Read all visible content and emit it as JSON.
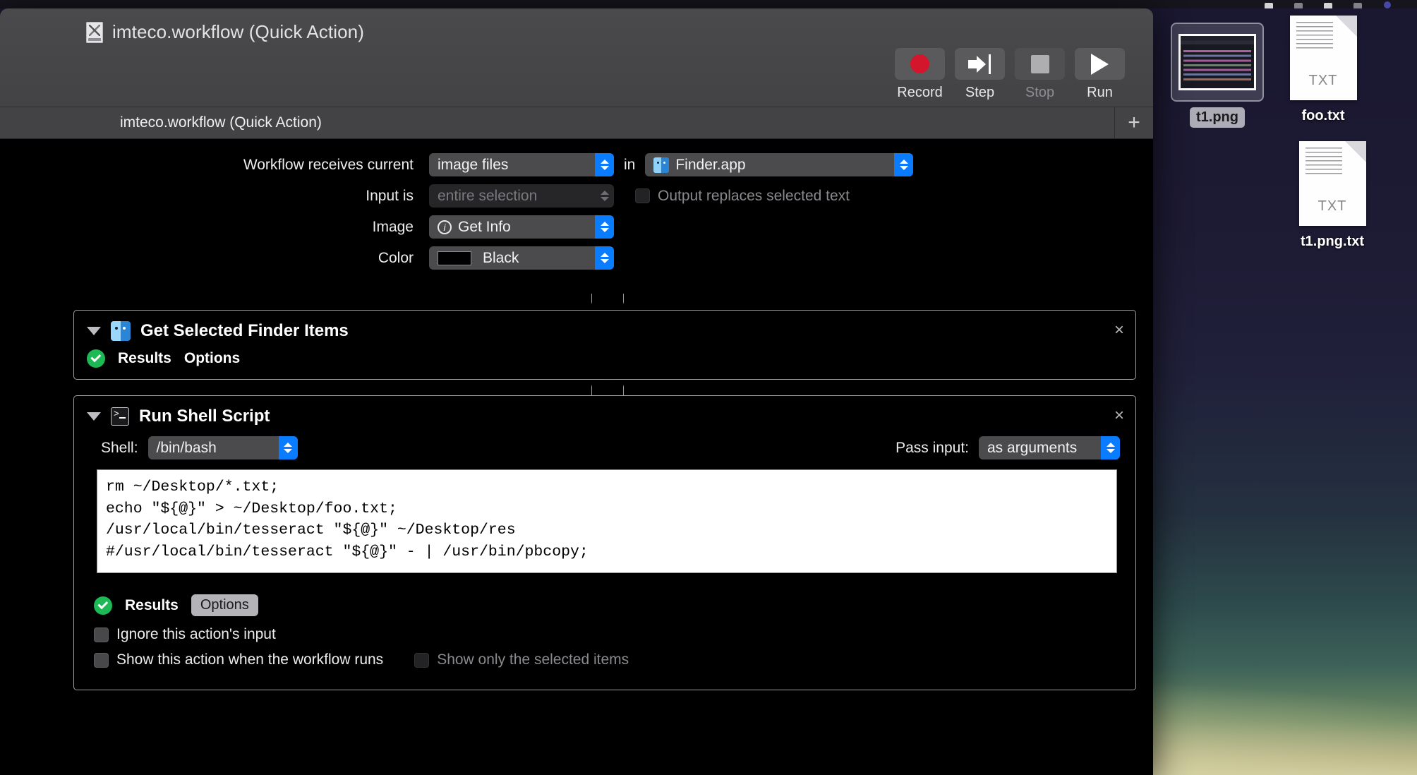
{
  "window": {
    "title": "imteco.workflow (Quick Action)",
    "doc_icon": "workflow-document-icon"
  },
  "toolbar": {
    "buttons": [
      {
        "label": "Record",
        "icon": "record-circle-icon",
        "enabled": true
      },
      {
        "label": "Step",
        "icon": "step-arrow-icon",
        "enabled": true
      },
      {
        "label": "Stop",
        "icon": "stop-square-icon",
        "enabled": false
      },
      {
        "label": "Run",
        "icon": "play-triangle-icon",
        "enabled": true
      }
    ]
  },
  "tabs": {
    "active_label": "imteco.workflow (Quick Action)",
    "add_label": "+"
  },
  "settings": {
    "receives_label": "Workflow receives current",
    "receives_value": "image files",
    "in_label": "in",
    "app_value": "Finder.app",
    "input_is_label": "Input is",
    "input_is_value": "entire selection",
    "output_replaces_label": "Output replaces selected text",
    "image_label": "Image",
    "image_value": "Get Info",
    "color_label": "Color",
    "color_value": "Black",
    "color_hex": "#000000"
  },
  "actions": [
    {
      "title": "Get Selected Finder Items",
      "icon": "finder-icon",
      "close_label": "×",
      "results_label": "Results",
      "options_label": "Options"
    },
    {
      "title": "Run Shell Script",
      "icon": "terminal-icon",
      "close_label": "×",
      "shell_label": "Shell:",
      "shell_value": "/bin/bash",
      "pass_input_label": "Pass input:",
      "pass_input_value": "as arguments",
      "script": "rm ~/Desktop/*.txt;\necho \"${@}\" > ~/Desktop/foo.txt;\n/usr/local/bin/tesseract \"${@}\" ~/Desktop/res\n#/usr/local/bin/tesseract \"${@}\" - | /usr/bin/pbcopy;",
      "results_label": "Results",
      "options_label": "Options",
      "checkboxes": [
        {
          "label": "Ignore this action's input",
          "checked": false,
          "enabled": true
        },
        {
          "label": "Show this action when the workflow runs",
          "checked": false,
          "enabled": true
        },
        {
          "label": "Show only the selected items",
          "checked": false,
          "enabled": false
        }
      ]
    }
  ],
  "desktop": {
    "icons": [
      {
        "name": "t1.png",
        "kind": "image-thumbnail",
        "selected": true
      },
      {
        "name": "foo.txt",
        "kind": "text-document",
        "ext": "TXT",
        "selected": false
      },
      {
        "name": "t1.png.txt",
        "kind": "text-document",
        "ext": "TXT",
        "selected": false
      }
    ]
  },
  "colors": {
    "accent_blue": "#0a7cff",
    "record_red": "#d3162b",
    "success_green": "#1db954",
    "window_chrome": "#434345"
  }
}
